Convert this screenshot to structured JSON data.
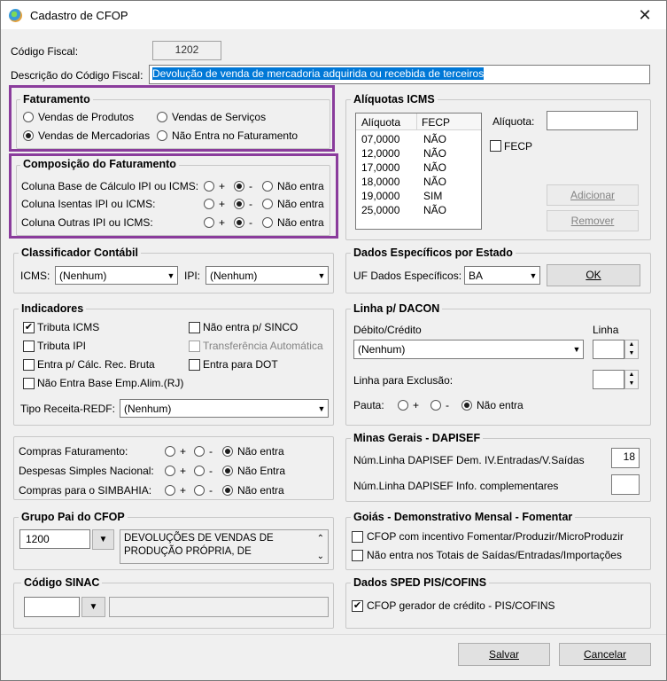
{
  "window": {
    "title": "Cadastro de CFOP",
    "close": "✕"
  },
  "codigo_fiscal": {
    "label": "Código Fiscal:",
    "value": "1202"
  },
  "descricao": {
    "label": "Descrição do Código Fiscal:",
    "value": "Devolução de venda de mercadoria adquirida ou recebida de terceiros"
  },
  "faturamento": {
    "title": "Faturamento",
    "options": [
      "Vendas de Produtos",
      "Vendas de Serviços",
      "Vendas de Mercadorias",
      "Não Entra no Faturamento"
    ],
    "selected": "Vendas de Mercadorias"
  },
  "composicao": {
    "title": "Composição do Faturamento",
    "rows": [
      {
        "label": "Coluna Base de Cálculo IPI ou ICMS:",
        "selected": "-"
      },
      {
        "label": "Coluna Isentas IPI ou ICMS:",
        "selected": "-"
      },
      {
        "label": "Coluna Outras IPI ou ICMS:",
        "selected": "-"
      }
    ],
    "plus": "+",
    "minus": "-",
    "none": "Não entra"
  },
  "aliquotas": {
    "title": "Alíquotas ICMS",
    "columns": [
      "Alíquota",
      "FECP"
    ],
    "rows": [
      [
        "07,0000",
        "NÃO"
      ],
      [
        "12,0000",
        "NÃO"
      ],
      [
        "17,0000",
        "NÃO"
      ],
      [
        "18,0000",
        "NÃO"
      ],
      [
        "19,0000",
        "SIM"
      ],
      [
        "25,0000",
        "NÃO"
      ]
    ],
    "aliquota_label": "Alíquota:",
    "aliquota_value": "",
    "fecp_label": "FECP",
    "add": "Adicionar",
    "remove": "Remover"
  },
  "classificador": {
    "title": "Classificador Contábil",
    "icms_label": "ICMS:",
    "icms_value": "(Nenhum)",
    "ipi_label": "IPI:",
    "ipi_value": "(Nenhum)"
  },
  "dados_estado": {
    "title": "Dados Específicos por Estado",
    "uf_label": "UF Dados Específicos:",
    "uf_value": "BA",
    "ok": "OK"
  },
  "indicadores": {
    "title": "Indicadores",
    "items": [
      {
        "label": "Tributa ICMS",
        "checked": true
      },
      {
        "label": "Tributa IPI",
        "checked": false
      },
      {
        "label": "Entra p/ Cálc. Rec. Bruta",
        "checked": false
      },
      {
        "label": "Não Entra Base Emp.Alim.(RJ)",
        "checked": false
      },
      {
        "label": "Não entra p/ SINCO",
        "checked": false
      },
      {
        "label": "Transferência Automática",
        "checked": false
      },
      {
        "label": "Entra para DOT",
        "checked": false
      }
    ],
    "tipo_label": "Tipo Receita-REDF:",
    "tipo_value": "(Nenhum)"
  },
  "dacon": {
    "title": "Linha p/ DACON",
    "debito_label": "Débito/Crédito",
    "debito_value": "(Nenhum)",
    "linha_label": "Linha",
    "linha_value": "",
    "exclusao_label": "Linha para Exclusão:",
    "exclusao_value": "",
    "pauta_label": "Pauta:",
    "plus": "+",
    "minus": "-",
    "none": "Não entra"
  },
  "compras": {
    "rows": [
      {
        "label": "Compras Faturamento:",
        "none": "Não entra"
      },
      {
        "label": "Despesas Simples Nacional:",
        "none": "Não Entra"
      },
      {
        "label": "Compras para o SIMBAHIA:",
        "none": "Não entra"
      }
    ],
    "plus": "+",
    "minus": "-"
  },
  "minas": {
    "title": "Minas Gerais - DAPISEF",
    "dem_label": "Núm.Linha DAPISEF Dem. IV.Entradas/V.Saídas",
    "dem_value": "18",
    "info_label": "Núm.Linha DAPISEF Info. complementares",
    "info_value": ""
  },
  "grupo_pai": {
    "title": "Grupo Pai do CFOP",
    "code": "1200",
    "description": "DEVOLUÇÕES DE VENDAS DE PRODUÇÃO PRÓPRIA, DE"
  },
  "goias": {
    "title": "Goiás - Demonstrativo Mensal - Fomentar",
    "items": [
      "CFOP com incentivo  Fomentar/Produzir/MicroProduzir",
      "Não entra nos Totais de  Saídas/Entradas/Importações"
    ]
  },
  "sinac": {
    "title": "Código SINAC",
    "code": "",
    "description": ""
  },
  "sped": {
    "title": "Dados SPED PIS/COFINS",
    "item": "CFOP gerador de crédito - PIS/COFINS",
    "checked": true
  },
  "footer": {
    "save": "Salvar",
    "cancel": "Cancelar"
  },
  "colors": {
    "highlight": "#8a3c9c",
    "selection": "#0078d7"
  }
}
